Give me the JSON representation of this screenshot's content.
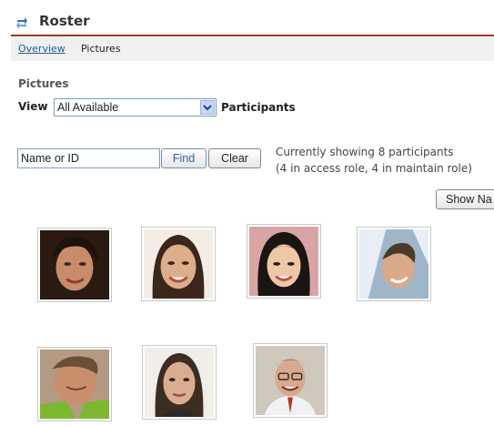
{
  "header": {
    "title": "Roster",
    "icon": "swap-arrows-icon"
  },
  "nav": {
    "overview_label": "Overview",
    "current_label": "Pictures"
  },
  "section": {
    "title": "Pictures"
  },
  "view": {
    "label": "View",
    "selected": "All Available",
    "participants_label": "Participants"
  },
  "search": {
    "value": "Name or ID",
    "find_label": "Find",
    "clear_label": "Clear"
  },
  "status": {
    "line1": "Currently showing 8 participants",
    "line2": "(4 in access role, 4 in maintain role)"
  },
  "show_button_label": "Show Na",
  "colors": {
    "accent_rule": "#a0341a",
    "link": "#1f5a9b",
    "nav_bg": "#f0f0f0"
  },
  "photos": [
    {
      "name": "participant-photo-1"
    },
    {
      "name": "participant-photo-2"
    },
    {
      "name": "participant-photo-3"
    },
    {
      "name": "participant-photo-4"
    },
    {
      "name": "participant-photo-5"
    },
    {
      "name": "participant-photo-6"
    },
    {
      "name": "participant-photo-7"
    }
  ]
}
